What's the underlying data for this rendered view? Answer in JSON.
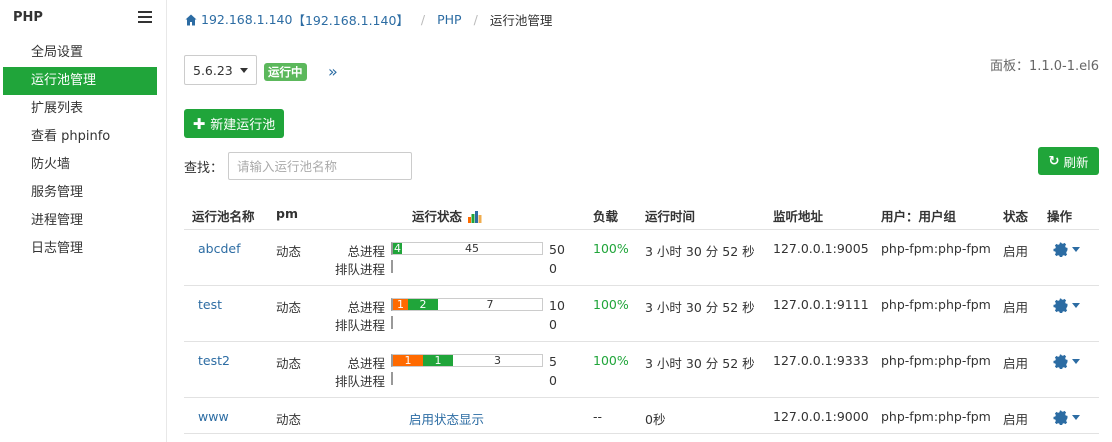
{
  "sidebar": {
    "title": "PHP",
    "items": [
      {
        "label": "全局设置",
        "active": false
      },
      {
        "label": "运行池管理",
        "active": true
      },
      {
        "label": "扩展列表",
        "active": false
      },
      {
        "label": "查看 phpinfo",
        "active": false
      },
      {
        "label": "防火墙",
        "active": false
      },
      {
        "label": "服务管理",
        "active": false
      },
      {
        "label": "进程管理",
        "active": false
      },
      {
        "label": "日志管理",
        "active": false
      }
    ]
  },
  "breadcrumb": {
    "host": "192.168.1.140",
    "host_bracket": "【192.168.1.140】",
    "section": "PHP",
    "current": "运行池管理"
  },
  "toolbar": {
    "version_selected": "5.6.23",
    "status_badge": "运行中",
    "more_icon": "»",
    "panel_version": "面板：1.1.0-1.el6",
    "new_pool_button": "新建运行池",
    "search_label": "查找：",
    "search_placeholder": "请输入运行池名称",
    "search_value": "",
    "refresh_button": "刷新"
  },
  "colors": {
    "accent": "#20a53a",
    "link": "#2c6ca3",
    "busy": "#ff6a00",
    "idle": "#20a53a"
  },
  "table": {
    "headers": {
      "name": "运行池名称",
      "pm": "pm",
      "status": "运行状态",
      "load": "负载",
      "uptime": "运行时间",
      "address": "监听地址",
      "user": "用户：用户组",
      "state": "状态",
      "actions": "操作"
    },
    "status_labels": {
      "total": "总进程",
      "queue": "排队进程"
    },
    "rows": [
      {
        "name": "abcdef",
        "pm": "动态",
        "busy": "",
        "idle": "4",
        "rest": "45",
        "total": "50",
        "queue": "0",
        "load": "100%",
        "uptime": "3 小时 30 分 52 秒",
        "address": "127.0.0.1:9005",
        "user": "php-fpm:php-fpm",
        "state": "启用"
      },
      {
        "name": "test",
        "pm": "动态",
        "busy": "1",
        "idle": "2",
        "rest": "7",
        "total": "10",
        "queue": "0",
        "load": "100%",
        "uptime": "3 小时 30 分 52 秒",
        "address": "127.0.0.1:9111",
        "user": "php-fpm:php-fpm",
        "state": "启用"
      },
      {
        "name": "test2",
        "pm": "动态",
        "busy": "1",
        "idle": "1",
        "rest": "3",
        "total": "5",
        "queue": "0",
        "load": "100%",
        "uptime": "3 小时 30 分 52 秒",
        "address": "127.0.0.1:9333",
        "user": "php-fpm:php-fpm",
        "state": "启用"
      },
      {
        "name": "www",
        "pm": "动态",
        "status_link": "启用状态显示",
        "load": "--",
        "uptime": "0秒",
        "address": "127.0.0.1:9000",
        "user": "php-fpm:php-fpm",
        "state": "启用"
      }
    ]
  }
}
